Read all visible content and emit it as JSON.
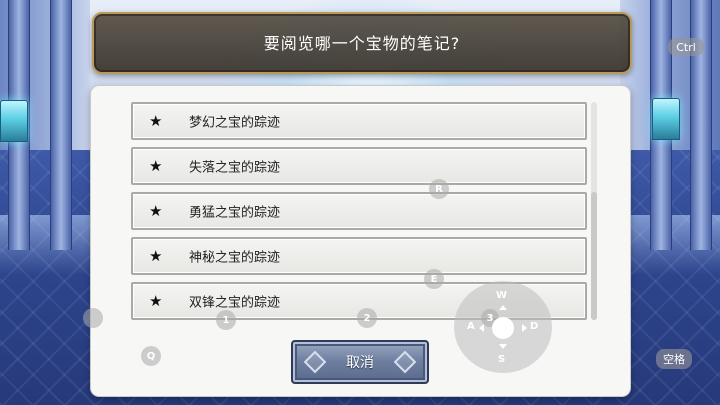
{
  "title": "要阅览哪一个宝物的笔记?",
  "items": [
    {
      "icon": "★",
      "label": "梦幻之宝的踪迹"
    },
    {
      "icon": "★",
      "label": "失落之宝的踪迹"
    },
    {
      "icon": "★",
      "label": "勇猛之宝的踪迹"
    },
    {
      "icon": "★",
      "label": "神秘之宝的踪迹"
    },
    {
      "icon": "★",
      "label": "双锋之宝的踪迹"
    }
  ],
  "cancel_label": "取消",
  "overlay_keys": {
    "ctrl": "Ctrl",
    "space": "空格",
    "r": "R",
    "e": "E",
    "q": "Q",
    "one": "1",
    "two": "2",
    "three": "3",
    "w": "W",
    "a": "A",
    "s": "S",
    "d": "D"
  },
  "colors": {
    "banner_border": "#b89a5c",
    "dialog_bg": "#f7f7f5",
    "cancel_button": "#6d7d9e"
  }
}
